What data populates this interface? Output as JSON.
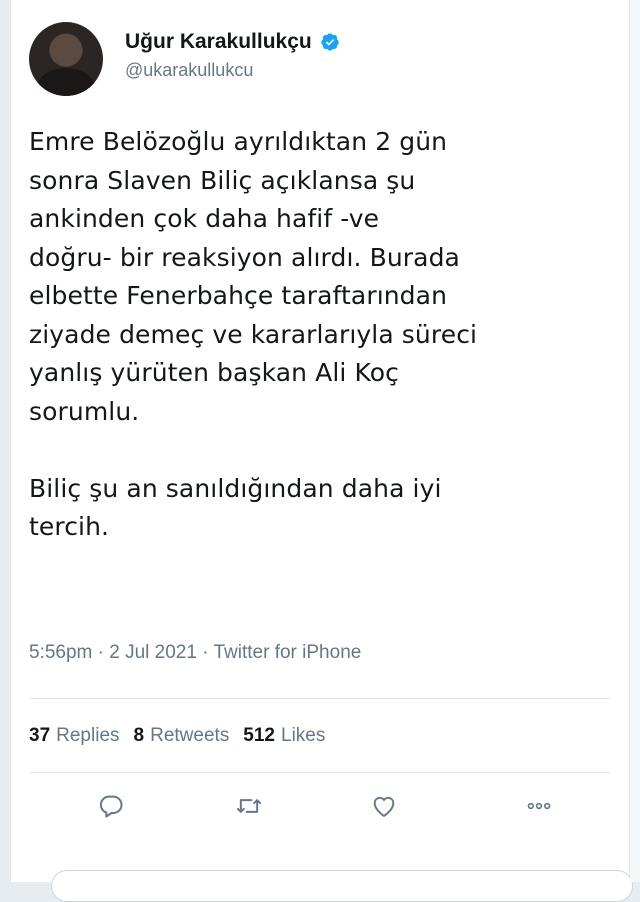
{
  "author": {
    "display_name": "Uğur Karakullukçu",
    "handle": "@ukarakullukcu",
    "verified": true,
    "avatar_icon": "user-avatar"
  },
  "tweet": {
    "text": "Emre Belözoğlu ayrıldıktan 2 gün\nsonra Slaven Biliç açıklansa şu\nankinden çok daha hafif -ve\ndoğru- bir reaksiyon alırdı. Burada\nelbette Fenerbahçe taraftarından\nziyade demeç ve kararlarıyla süreci\nyanlış yürüten başkan Ali Koç\nsorumlu.\n\nBiliç şu an sanıldığından daha iyi\ntercih.",
    "meta": "5:56pm · 2 Jul 2021 · Twitter for iPhone"
  },
  "stats": {
    "replies_count": "37",
    "replies_label": "Replies",
    "retweets_count": "8",
    "retweets_label": "Retweets",
    "likes_count": "512",
    "likes_label": "Likes"
  },
  "actions": {
    "reply_icon": "reply-icon",
    "retweet_icon": "retweet-icon",
    "like_icon": "heart-icon",
    "more_icon": "more-icon"
  },
  "colors": {
    "text_primary": "#14171a",
    "text_secondary": "#657786",
    "verified_blue": "#1da1f2",
    "divider": "#e1e8ed"
  }
}
